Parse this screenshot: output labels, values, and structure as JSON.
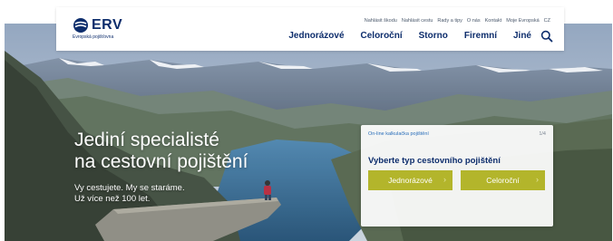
{
  "header": {
    "logo": {
      "name": "ERV",
      "subtitle": "Evropská pojišťovna"
    },
    "utility_nav": [
      "Nahlásit škodu",
      "Nahlásit cestu",
      "Rady a tipy",
      "O nás",
      "Kontakt",
      "Moje Evropská",
      "CZ"
    ],
    "main_nav": [
      "Jednorázové",
      "Celoroční",
      "Storno",
      "Firemní",
      "Jiné"
    ],
    "search_icon": "search-icon"
  },
  "hero": {
    "headline": [
      "Jediní specialisté",
      "na cestovní pojištění"
    ],
    "tagline": [
      "Vy cestujete. My se staráme.",
      "Už více než 100 let."
    ]
  },
  "calculator": {
    "label": "On-line kalkulačka pojištění",
    "step": "1/4",
    "title": "Vyberte typ cestovního pojištění",
    "options": [
      "Jednorázové",
      "Celoroční"
    ],
    "arrow_icon": "chevron-right-icon"
  },
  "colors": {
    "brand_navy": "#0d2d6c",
    "accent_olive": "#b3b52b",
    "link_blue": "#2b6fba"
  }
}
